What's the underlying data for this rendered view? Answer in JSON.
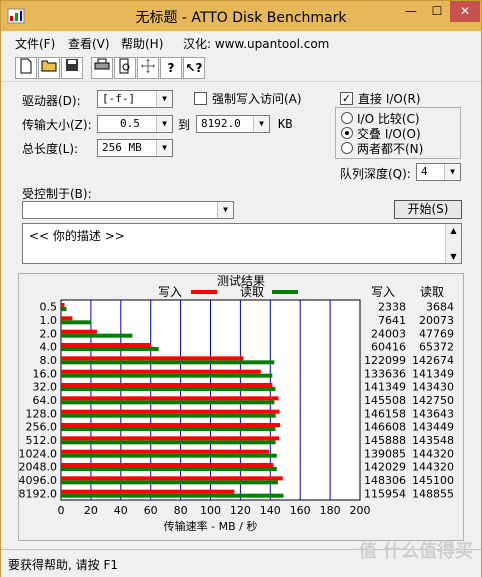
{
  "window": {
    "title": "无标题 - ATTO Disk Benchmark",
    "minimize": "—",
    "maximize": "☐",
    "close": "✕"
  },
  "menu": {
    "file": "文件(F)",
    "view": "查看(V)",
    "help": "帮助(H)",
    "hint": "汉化: www.upantool.com"
  },
  "toolbar": [
    "new-icon",
    "open-icon",
    "save-icon",
    "print-icon",
    "print-preview-icon",
    "move-icon",
    "help-icon",
    "context-help-icon"
  ],
  "settings": {
    "drive_label": "驱动器(D):",
    "drive_value": "[-f-]",
    "force_write_label": "强制写入访问(A)",
    "transfer_label": "传输大小(Z):",
    "transfer_from": "0.5",
    "to_label": "到",
    "transfer_to": "8192.0",
    "kb_label": "KB",
    "length_label": "总长度(L):",
    "length_value": "256 MB",
    "direct_io_label": "直接 I/O(R)",
    "io_compare_label": "I/O 比较(C)",
    "overlap_io_label": "交叠 I/O(O)",
    "neither_label": "两者都不(N)",
    "queue_label": "队列深度(Q):",
    "queue_value": "4",
    "controlled_by_label": "受控制于(B):",
    "controlled_by_value": "",
    "start_button": "开始(S)",
    "description": "<<  你的描述  >>"
  },
  "results": {
    "title": "测试结果",
    "legend_write": "写入",
    "legend_read": "读取",
    "col_write": "写入",
    "col_read": "读取",
    "write_color": "#ff0000",
    "read_color": "#008000"
  },
  "chart_data": {
    "type": "bar",
    "orientation": "horizontal",
    "categories": [
      "0.5",
      "1.0",
      "2.0",
      "4.0",
      "8.0",
      "16.0",
      "32.0",
      "64.0",
      "128.0",
      "256.0",
      "512.0",
      "1024.0",
      "2048.0",
      "4096.0",
      "8192.0"
    ],
    "series": [
      {
        "name": "写入",
        "values": [
          2338,
          7641,
          24003,
          60416,
          122099,
          133636,
          141349,
          145508,
          146158,
          146608,
          145888,
          139085,
          142029,
          148306,
          115954
        ]
      },
      {
        "name": "读取",
        "values": [
          3684,
          20073,
          47769,
          65372,
          142674,
          141349,
          143430,
          142750,
          143643,
          143449,
          143548,
          144320,
          144320,
          145100,
          148855
        ]
      }
    ],
    "xlabel": "传输速率 - MB / 秒",
    "xlim": [
      0,
      200
    ],
    "xticks": [
      "0",
      "20",
      "40",
      "60",
      "80",
      "100",
      "120",
      "140",
      "160",
      "180",
      "200"
    ],
    "grid": true
  },
  "status": {
    "text": "要获得帮助, 请按 F1",
    "watermark": "值 什么值得买"
  }
}
